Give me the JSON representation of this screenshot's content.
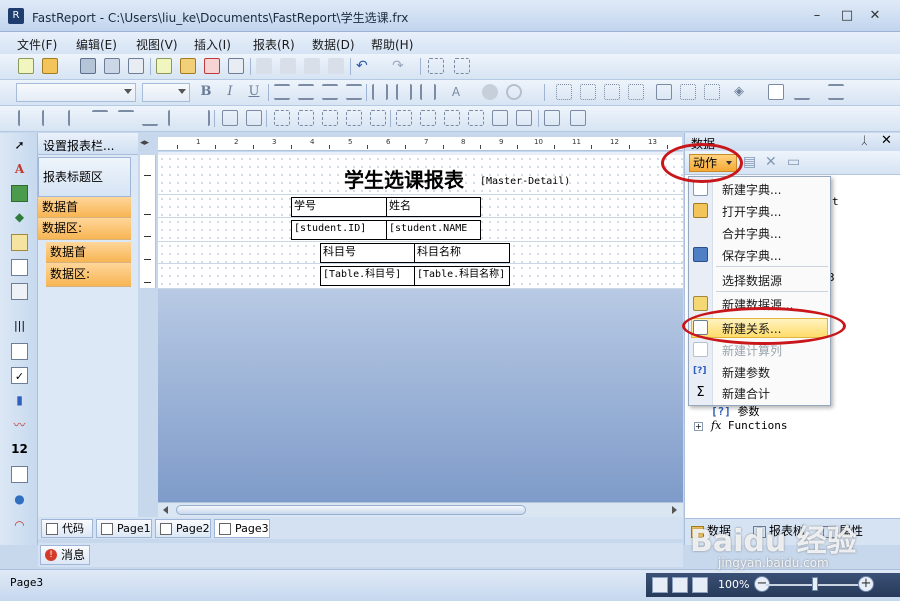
{
  "window": {
    "title": "FastReport - C:\\Users\\liu_ke\\Documents\\FastReport\\学生选课.frx",
    "app_icon": "R"
  },
  "menu": [
    "文件(F)",
    "编辑(E)",
    "视图(V)",
    "插入(I)",
    "报表(R)",
    "数据(D)",
    "帮助(H)"
  ],
  "bands_panel": {
    "header": "设置报表栏...",
    "bands": [
      "报表标题区",
      "数据首",
      "数据区:",
      "数据首",
      "数据区:"
    ]
  },
  "ruler": {
    "numbers": [
      "1",
      "2",
      "3",
      "4",
      "5",
      "6",
      "7",
      "8",
      "9",
      "10",
      "11",
      "12",
      "13"
    ]
  },
  "report": {
    "title": "学生选课报表",
    "master_detail_label": "[Master-Detail)",
    "student_headers": [
      "学号",
      "姓名"
    ],
    "student_fields": [
      "[student.ID]",
      "[student.NAME"
    ],
    "course_headers": [
      "科目号",
      "科目名称"
    ],
    "course_fields": [
      "[Table.科目号]",
      "[Table.科目名称]"
    ]
  },
  "page_tabs": [
    "代码",
    "Page1",
    "Page2",
    "Page3"
  ],
  "messages_tab": "消息",
  "status": {
    "page": "Page3",
    "zoom": "100%"
  },
  "data_panel": {
    "title": "数据",
    "pin": "ᛸ",
    "close": "✕",
    "action_button": "动作",
    "tree_behind": [
      {
        "label": "t"
      },
      {
        "label": "3"
      }
    ],
    "tree_params": "参数",
    "tree_functions": "Functions",
    "tabs": [
      "数据",
      "报表树",
      "属性"
    ]
  },
  "action_menu": {
    "items": [
      {
        "label": "新建字典...",
        "disabled": false
      },
      {
        "label": "打开字典...",
        "disabled": false
      },
      {
        "label": "合并字典...",
        "disabled": false
      },
      {
        "label": "保存字典...",
        "disabled": false
      },
      {
        "label": "选择数据源",
        "disabled": false
      },
      {
        "label": "新建数据源...",
        "disabled": false
      },
      {
        "label": "新建关系...",
        "disabled": false
      },
      {
        "label": "新建计算列",
        "disabled": true
      },
      {
        "label": "新建参数",
        "disabled": false
      },
      {
        "label": "新建合计",
        "disabled": false
      }
    ],
    "highlighted": "新建关系..."
  },
  "watermark": {
    "brand": "Baidu 经验",
    "url": "jingyan.baidu.com"
  },
  "colors": {
    "highlight_ellipse": "#c8161a",
    "band_orange": "#f7b553",
    "menu_highlight": "#ffdc6b"
  }
}
